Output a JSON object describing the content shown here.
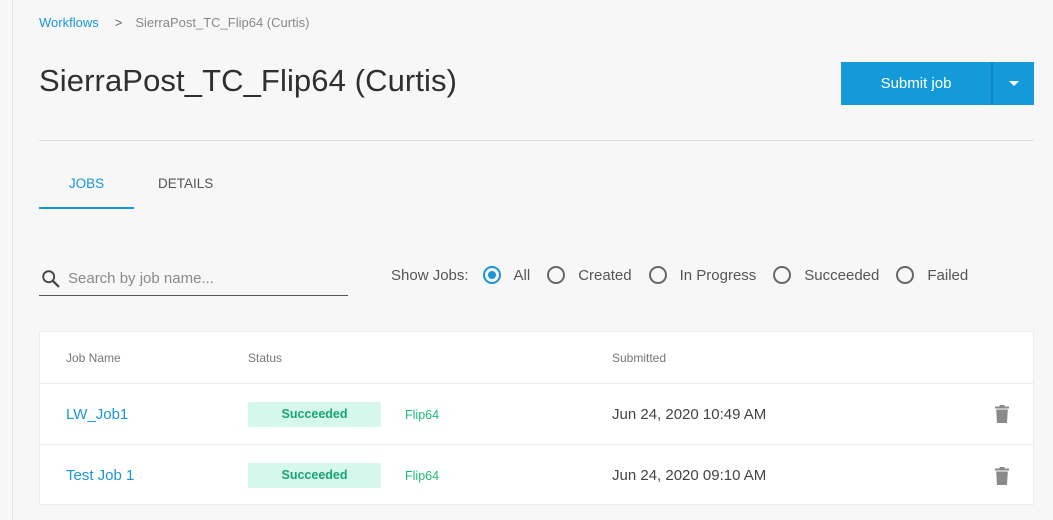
{
  "breadcrumb": {
    "root": "Workflows",
    "separator": ">",
    "current": "SierraPost_TC_Flip64 (Curtis)"
  },
  "page": {
    "title": "SierraPost_TC_Flip64 (Curtis)"
  },
  "actions": {
    "submit_label": "Submit job",
    "dropdown_icon": "caret-down-icon"
  },
  "tabs": [
    {
      "label": "JOBS",
      "active": true
    },
    {
      "label": "DETAILS",
      "active": false
    }
  ],
  "search": {
    "placeholder": "Search by job name...",
    "value": ""
  },
  "filter": {
    "label": "Show Jobs:",
    "options": [
      {
        "label": "All",
        "checked": true
      },
      {
        "label": "Created",
        "checked": false
      },
      {
        "label": "In Progress",
        "checked": false
      },
      {
        "label": "Succeeded",
        "checked": false
      },
      {
        "label": "Failed",
        "checked": false
      }
    ]
  },
  "table": {
    "columns": [
      "Job Name",
      "Status",
      "",
      "Submitted",
      ""
    ],
    "rows": [
      {
        "name": "LW_Job1",
        "status": "Succeeded",
        "tag": "Flip64",
        "submitted": "Jun 24, 2020 10:49 AM"
      },
      {
        "name": "Test Job 1",
        "status": "Succeeded",
        "tag": "Flip64",
        "submitted": "Jun 24, 2020 09:10 AM"
      }
    ]
  },
  "colors": {
    "accent": "#1a95d8",
    "button": "#159ad9",
    "status_bg": "#d5f7ec",
    "status_text": "#1aa472"
  }
}
